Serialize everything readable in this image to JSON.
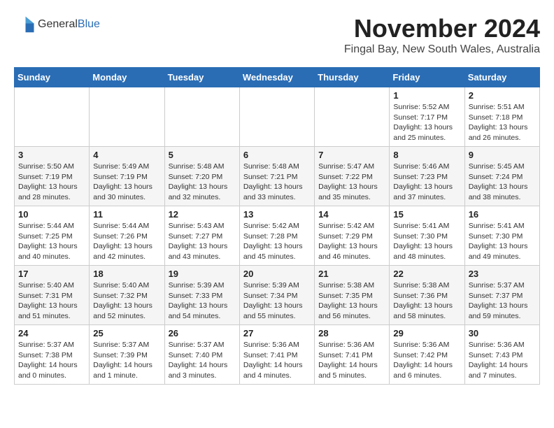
{
  "app": {
    "name_general": "General",
    "name_blue": "Blue"
  },
  "header": {
    "month_year": "November 2024",
    "location": "Fingal Bay, New South Wales, Australia"
  },
  "weekdays": [
    "Sunday",
    "Monday",
    "Tuesday",
    "Wednesday",
    "Thursday",
    "Friday",
    "Saturday"
  ],
  "weeks": [
    [
      {
        "day": "",
        "info": ""
      },
      {
        "day": "",
        "info": ""
      },
      {
        "day": "",
        "info": ""
      },
      {
        "day": "",
        "info": ""
      },
      {
        "day": "",
        "info": ""
      },
      {
        "day": "1",
        "info": "Sunrise: 5:52 AM\nSunset: 7:17 PM\nDaylight: 13 hours\nand 25 minutes."
      },
      {
        "day": "2",
        "info": "Sunrise: 5:51 AM\nSunset: 7:18 PM\nDaylight: 13 hours\nand 26 minutes."
      }
    ],
    [
      {
        "day": "3",
        "info": "Sunrise: 5:50 AM\nSunset: 7:19 PM\nDaylight: 13 hours\nand 28 minutes."
      },
      {
        "day": "4",
        "info": "Sunrise: 5:49 AM\nSunset: 7:19 PM\nDaylight: 13 hours\nand 30 minutes."
      },
      {
        "day": "5",
        "info": "Sunrise: 5:48 AM\nSunset: 7:20 PM\nDaylight: 13 hours\nand 32 minutes."
      },
      {
        "day": "6",
        "info": "Sunrise: 5:48 AM\nSunset: 7:21 PM\nDaylight: 13 hours\nand 33 minutes."
      },
      {
        "day": "7",
        "info": "Sunrise: 5:47 AM\nSunset: 7:22 PM\nDaylight: 13 hours\nand 35 minutes."
      },
      {
        "day": "8",
        "info": "Sunrise: 5:46 AM\nSunset: 7:23 PM\nDaylight: 13 hours\nand 37 minutes."
      },
      {
        "day": "9",
        "info": "Sunrise: 5:45 AM\nSunset: 7:24 PM\nDaylight: 13 hours\nand 38 minutes."
      }
    ],
    [
      {
        "day": "10",
        "info": "Sunrise: 5:44 AM\nSunset: 7:25 PM\nDaylight: 13 hours\nand 40 minutes."
      },
      {
        "day": "11",
        "info": "Sunrise: 5:44 AM\nSunset: 7:26 PM\nDaylight: 13 hours\nand 42 minutes."
      },
      {
        "day": "12",
        "info": "Sunrise: 5:43 AM\nSunset: 7:27 PM\nDaylight: 13 hours\nand 43 minutes."
      },
      {
        "day": "13",
        "info": "Sunrise: 5:42 AM\nSunset: 7:28 PM\nDaylight: 13 hours\nand 45 minutes."
      },
      {
        "day": "14",
        "info": "Sunrise: 5:42 AM\nSunset: 7:29 PM\nDaylight: 13 hours\nand 46 minutes."
      },
      {
        "day": "15",
        "info": "Sunrise: 5:41 AM\nSunset: 7:30 PM\nDaylight: 13 hours\nand 48 minutes."
      },
      {
        "day": "16",
        "info": "Sunrise: 5:41 AM\nSunset: 7:30 PM\nDaylight: 13 hours\nand 49 minutes."
      }
    ],
    [
      {
        "day": "17",
        "info": "Sunrise: 5:40 AM\nSunset: 7:31 PM\nDaylight: 13 hours\nand 51 minutes."
      },
      {
        "day": "18",
        "info": "Sunrise: 5:40 AM\nSunset: 7:32 PM\nDaylight: 13 hours\nand 52 minutes."
      },
      {
        "day": "19",
        "info": "Sunrise: 5:39 AM\nSunset: 7:33 PM\nDaylight: 13 hours\nand 54 minutes."
      },
      {
        "day": "20",
        "info": "Sunrise: 5:39 AM\nSunset: 7:34 PM\nDaylight: 13 hours\nand 55 minutes."
      },
      {
        "day": "21",
        "info": "Sunrise: 5:38 AM\nSunset: 7:35 PM\nDaylight: 13 hours\nand 56 minutes."
      },
      {
        "day": "22",
        "info": "Sunrise: 5:38 AM\nSunset: 7:36 PM\nDaylight: 13 hours\nand 58 minutes."
      },
      {
        "day": "23",
        "info": "Sunrise: 5:37 AM\nSunset: 7:37 PM\nDaylight: 13 hours\nand 59 minutes."
      }
    ],
    [
      {
        "day": "24",
        "info": "Sunrise: 5:37 AM\nSunset: 7:38 PM\nDaylight: 14 hours\nand 0 minutes."
      },
      {
        "day": "25",
        "info": "Sunrise: 5:37 AM\nSunset: 7:39 PM\nDaylight: 14 hours\nand 1 minute."
      },
      {
        "day": "26",
        "info": "Sunrise: 5:37 AM\nSunset: 7:40 PM\nDaylight: 14 hours\nand 3 minutes."
      },
      {
        "day": "27",
        "info": "Sunrise: 5:36 AM\nSunset: 7:41 PM\nDaylight: 14 hours\nand 4 minutes."
      },
      {
        "day": "28",
        "info": "Sunrise: 5:36 AM\nSunset: 7:41 PM\nDaylight: 14 hours\nand 5 minutes."
      },
      {
        "day": "29",
        "info": "Sunrise: 5:36 AM\nSunset: 7:42 PM\nDaylight: 14 hours\nand 6 minutes."
      },
      {
        "day": "30",
        "info": "Sunrise: 5:36 AM\nSunset: 7:43 PM\nDaylight: 14 hours\nand 7 minutes."
      }
    ]
  ]
}
